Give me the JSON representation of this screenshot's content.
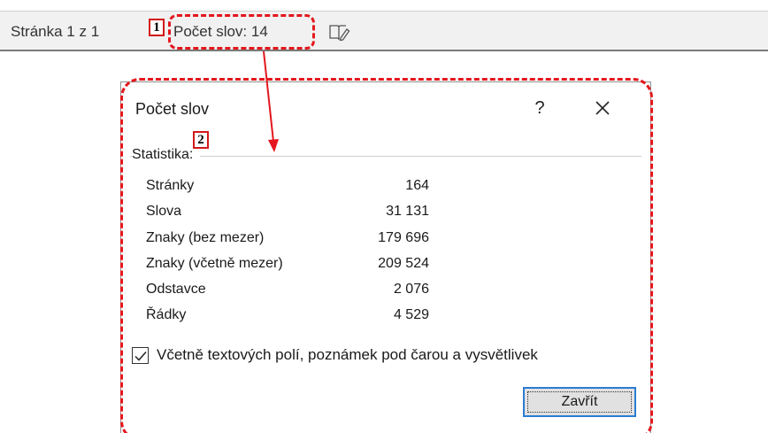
{
  "statusbar": {
    "page_label": "Stránka 1 z 1",
    "words_label": "Počet slov: 14"
  },
  "markers": {
    "first": "1",
    "second": "2"
  },
  "dialog": {
    "title": "Počet slov",
    "help": "?",
    "group_label": "Statistika:",
    "stats": [
      {
        "label": "Stránky",
        "value": "164"
      },
      {
        "label": "Slova",
        "value": "31 131"
      },
      {
        "label": "Znaky (bez mezer)",
        "value": "179 696"
      },
      {
        "label": "Znaky (včetně mezer)",
        "value": "209 524"
      },
      {
        "label": "Odstavce",
        "value": "2 076"
      },
      {
        "label": "Řádky",
        "value": "4 529"
      }
    ],
    "include_checkbox": {
      "label": "Včetně textových polí, poznámek pod čarou a vysvětlivek",
      "checked": true
    },
    "close_button": "Zavřít"
  },
  "colors": {
    "annotation_red": "#e3171d",
    "focus_blue": "#2b7cd3"
  },
  "icons": {
    "proofing": "proofing-icon",
    "close": "close-icon",
    "check": "check-icon",
    "arrow": "arrow-icon"
  }
}
